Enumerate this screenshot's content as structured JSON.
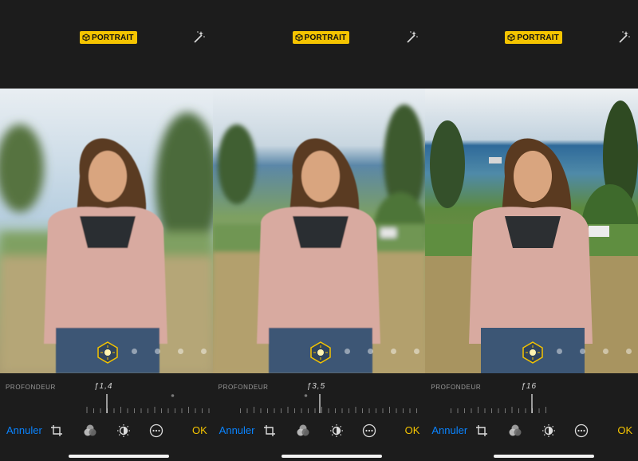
{
  "panes": [
    {
      "badge": "PORTRAIT",
      "depth_label": "PROFONDEUR",
      "aperture": "ƒ1,4",
      "aperture_fraction": 0.1,
      "cancel": "Annuler",
      "ok": "OK"
    },
    {
      "badge": "PORTRAIT",
      "depth_label": "PROFONDEUR",
      "aperture": "ƒ3,5",
      "aperture_fraction": 0.5,
      "cancel": "Annuler",
      "ok": "OK"
    },
    {
      "badge": "PORTRAIT",
      "depth_label": "PROFONDEUR",
      "aperture": "ƒ16",
      "aperture_fraction": 0.95,
      "cancel": "Annuler",
      "ok": "OK"
    }
  ],
  "colors": {
    "accent_yellow": "#f5c400",
    "link_blue": "#0a84ff",
    "background": "#1c1c1c"
  },
  "icons": [
    "portrait-cube-icon",
    "magic-wand-icon",
    "crop-rotate-icon",
    "filters-icon",
    "adjust-icon",
    "more-icon",
    "portrait-lighting-icon"
  ]
}
